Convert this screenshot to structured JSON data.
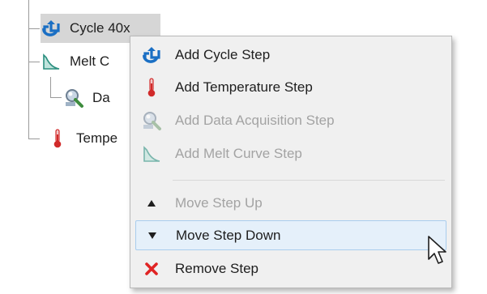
{
  "tree": {
    "nodes": [
      {
        "label": "Cycle 40x",
        "icon": "cycle-icon",
        "selected": true
      },
      {
        "label": "Melt C",
        "icon": "melt-curve-icon"
      },
      {
        "label": "Da",
        "icon": "data-acquisition-icon"
      },
      {
        "label": "Tempe",
        "icon": "thermometer-icon"
      }
    ]
  },
  "context_menu": {
    "items": [
      {
        "label": "Add Cycle Step",
        "icon": "cycle-icon",
        "enabled": true
      },
      {
        "label": "Add Temperature Step",
        "icon": "thermometer-icon",
        "enabled": true
      },
      {
        "label": "Add Data Acquisition Step",
        "icon": "data-acquisition-icon",
        "enabled": false
      },
      {
        "label": "Add Melt Curve Step",
        "icon": "melt-curve-icon",
        "enabled": false
      },
      {
        "label": "Move Step Up",
        "icon": "triangle-up-icon",
        "enabled": false
      },
      {
        "label": "Move Step Down",
        "icon": "triangle-down-icon",
        "enabled": true,
        "hovered": true
      },
      {
        "label": "Remove Step",
        "icon": "red-x-icon",
        "enabled": true
      }
    ]
  },
  "colors": {
    "cycle_icon": "#1a6fc4",
    "melt_icon_fill": "#bfe3dc",
    "melt_icon_line": "#2b8f7f",
    "thermometer": "#d12a2a",
    "remove_x": "#e02424",
    "hover_bg": "#e5f0fa",
    "hover_border": "#a9cdee",
    "disabled_text": "#a3a3a3",
    "selected_bg": "#d6d6d6"
  }
}
